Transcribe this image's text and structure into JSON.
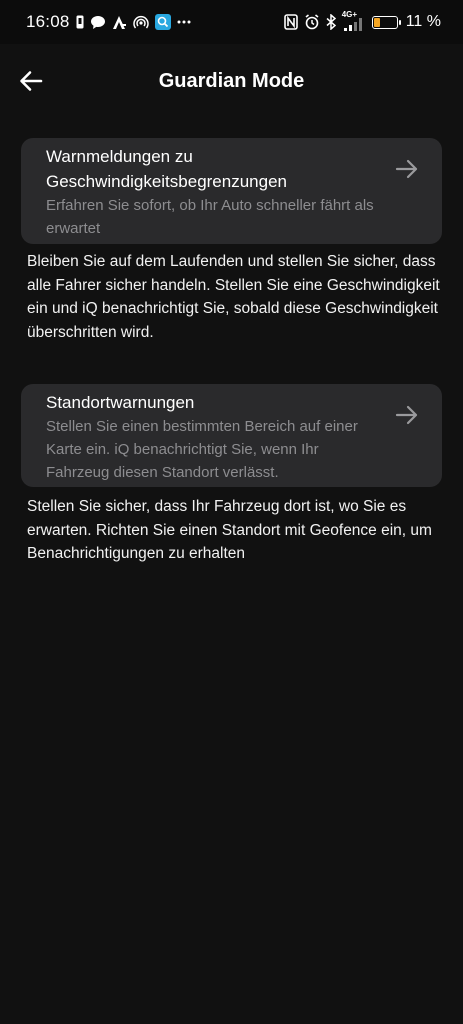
{
  "status_bar": {
    "time": "16:08",
    "battery_text": "11 %",
    "battery_level": 0.11,
    "network_label": "4G+",
    "left_icons": [
      "sim-icon",
      "chat-bubble-icon",
      "app-a-icon",
      "hotspot-icon",
      "search-app-icon",
      "more-dots-icon"
    ],
    "right_icons": [
      "nfc-icon",
      "alarm-icon",
      "bluetooth-icon",
      "signal-icon",
      "battery-icon"
    ]
  },
  "header": {
    "title": "Guardian Mode",
    "back_icon": "arrow-left-icon"
  },
  "sections": [
    {
      "card_title": "Warnmeldungen zu Geschwindigkeitsbegrenzungen",
      "card_subtitle": "Erfahren Sie sofort, ob Ihr Auto schneller fährt als erwartet",
      "description": "Bleiben Sie auf dem Laufenden und stellen Sie sicher, dass alle Fahrer sicher handeln. Stellen Sie eine Geschwindigkeit ein und iQ benachrichtigt Sie, sobald diese Geschwindigkeit überschritten wird.",
      "arrow_icon": "arrow-right-icon"
    },
    {
      "card_title": "Standortwarnungen",
      "card_subtitle": "Stellen Sie einen bestimmten Bereich auf einer Karte ein. iQ benachrichtigt Sie, wenn Ihr Fahrzeug diesen Standort verlässt.",
      "description": "Stellen Sie sicher, dass Ihr Fahrzeug dort ist, wo Sie es erwarten. Richten Sie einen Standort mit Geofence ein, um Benachrichtigungen zu erhalten",
      "arrow_icon": "arrow-right-icon"
    }
  ],
  "colors": {
    "background": "#111111",
    "card": "#2a2a2c",
    "subtitle": "#8d8d90",
    "battery_low": "#f5a623"
  }
}
